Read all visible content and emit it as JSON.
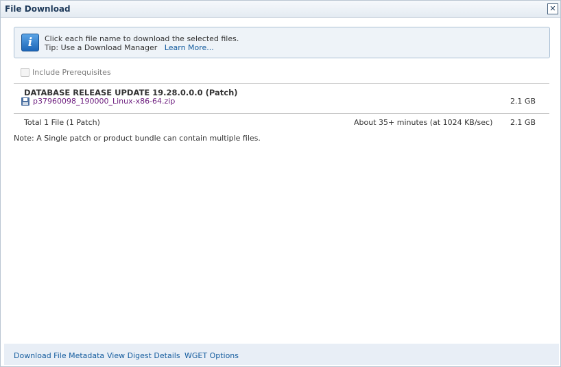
{
  "dialog": {
    "title": "File Download",
    "close_label": "✕"
  },
  "info": {
    "icon": "info-icon",
    "icon_glyph": "i",
    "line1": "Click each file name to download the selected files.",
    "tip_prefix": "Tip: Use a Download Manager",
    "learn_more": "Learn More..."
  },
  "prerequisites": {
    "label": "Include Prerequisites",
    "checked": false
  },
  "patch": {
    "title": "DATABASE RELEASE UPDATE 19.28.0.0.0 (Patch)",
    "file_icon": "floppy-disk-icon",
    "file_name": "p37960098_190000_Linux-x86-64.zip",
    "file_size": "2.1 GB"
  },
  "total": {
    "label": "Total 1 File (1 Patch)",
    "eta": "About 35+ minutes (at 1024 KB/sec)",
    "size": "2.1 GB"
  },
  "note": "Note: A Single patch or product bundle can contain multiple files.",
  "footer": {
    "metadata": "Download File Metadata",
    "digest": "View Digest Details",
    "wget": "WGET Options"
  },
  "colors": {
    "title": "#1e3a5a",
    "link": "#145c9e",
    "visited_link": "#6c1d7e",
    "info_bg": "#eef3f8",
    "footer_bg": "#e8eef6"
  }
}
